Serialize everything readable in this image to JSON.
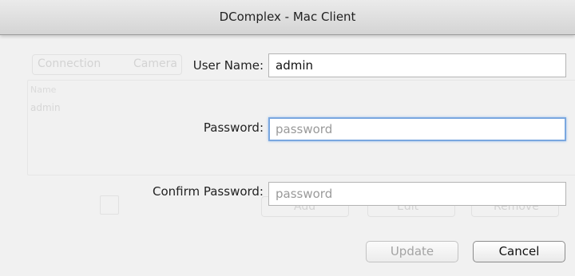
{
  "window": {
    "title": "DComplex - Mac Client"
  },
  "background": {
    "tabs": [
      "Connection",
      "Camera"
    ],
    "table": {
      "column": "Name",
      "rows": [
        "admin"
      ]
    },
    "buttons": [
      "Add",
      "Edit",
      "Remove"
    ]
  },
  "form": {
    "user_name_label": "User Name:",
    "user_name_value": "admin",
    "password_label": "Password:",
    "password_placeholder": "password",
    "confirm_label": "Confirm Password:",
    "confirm_placeholder": "password"
  },
  "buttons": {
    "update": "Update",
    "cancel": "Cancel"
  },
  "colors": {
    "focus_ring": "#7aa7df",
    "disabled_text": "#a3a3a3"
  }
}
